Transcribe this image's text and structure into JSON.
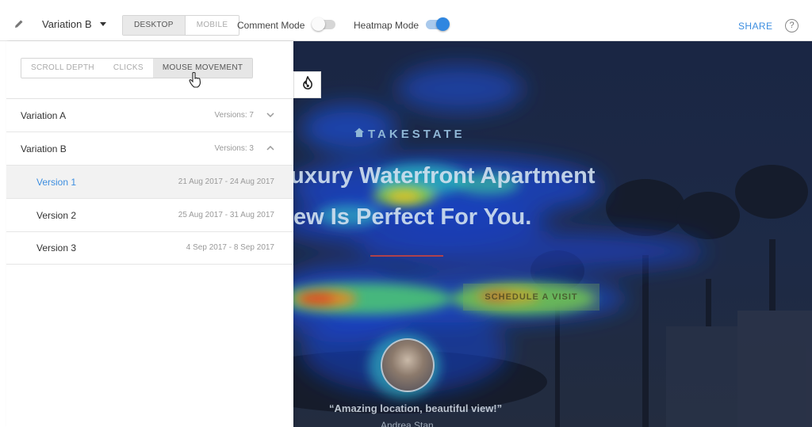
{
  "toolbar": {
    "variation_label": "Variation B",
    "device_tabs": [
      "DESKTOP",
      "MOBILE"
    ],
    "comment_mode_label": "Comment Mode",
    "comment_mode_on": false,
    "heatmap_mode_label": "Heatmap Mode",
    "heatmap_mode_on": true,
    "share_label": "SHARE",
    "help_label": "?",
    "accent_color": "#3d8ee0"
  },
  "panel": {
    "tabs": [
      "SCROLL DEPTH",
      "CLICKS",
      "MOUSE MOVEMENT"
    ],
    "active_tab": "MOUSE MOVEMENT",
    "variations": [
      {
        "name": "Variation A",
        "meta": "Versions: 7",
        "expanded": false
      },
      {
        "name": "Variation B",
        "meta": "Versions: 3",
        "expanded": true
      }
    ],
    "versions": [
      {
        "name": "Version 1",
        "dates": "21 Aug 2017 - 24 Aug 2017",
        "selected": true
      },
      {
        "name": "Version 2",
        "dates": "25 Aug 2017 - 31 Aug 2017",
        "selected": false
      },
      {
        "name": "Version 3",
        "dates": "4 Sep 2017 - 8 Sep 2017",
        "selected": false
      }
    ]
  },
  "preview": {
    "logo_text": "TAKESTATE",
    "headline_line1": "uxury Waterfront Apartment",
    "headline_line2": "ew Is Perfect For You.",
    "cta_label": "SCHEDULE A VISIT",
    "quote": "“Amazing location, beautiful view!”",
    "author": "Andrea Stan"
  }
}
